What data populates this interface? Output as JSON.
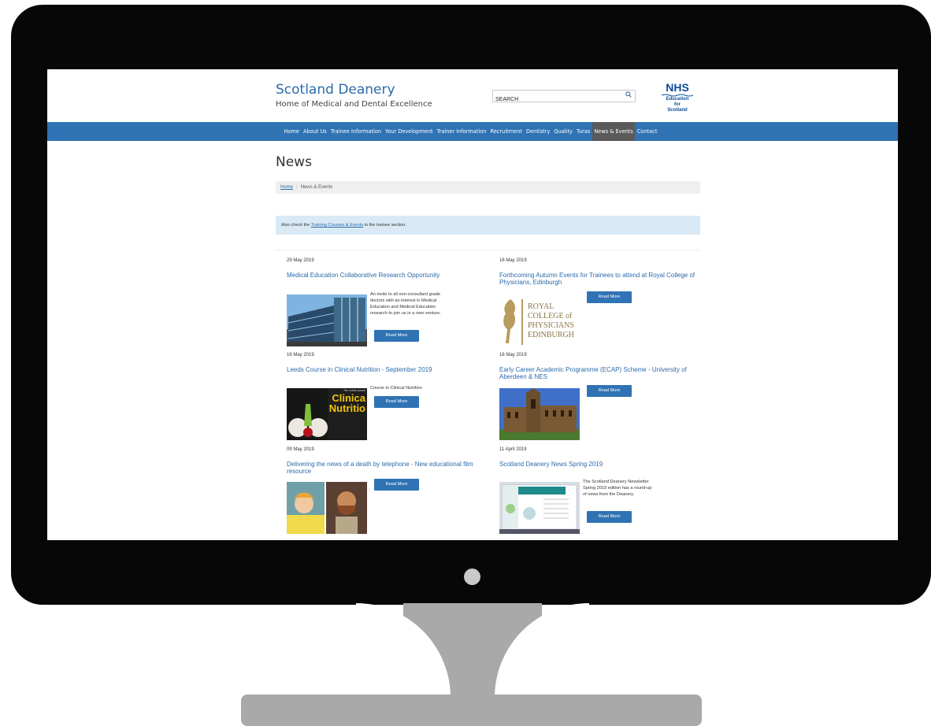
{
  "header": {
    "brand_title": "Scotland Deanery",
    "brand_subtitle": "Home of Medical and Dental Excellence",
    "search_placeholder": "SEARCH",
    "search_icon": "magnifier-icon",
    "nhs_logo": {
      "mark": "NHS",
      "line1": "Education",
      "line2": "for",
      "line3": "Scotland"
    }
  },
  "nav": {
    "items": [
      {
        "label": "Home"
      },
      {
        "label": "About Us"
      },
      {
        "label": "Trainee Information"
      },
      {
        "label": "Your Development"
      },
      {
        "label": "Trainer Information"
      },
      {
        "label": "Recruitment"
      },
      {
        "label": "Dentistry"
      },
      {
        "label": "Quality"
      },
      {
        "label": "Turas"
      },
      {
        "label": "News & Events"
      },
      {
        "label": "Contact"
      }
    ],
    "active": "News & Events"
  },
  "page": {
    "title": "News",
    "breadcrumb": {
      "home": "Home",
      "separator": "/",
      "current": "News & Events"
    },
    "alert": {
      "prefix": "Also check the ",
      "link": "Training Courses & Events",
      "suffix": " in the trainee section."
    }
  },
  "news": [
    {
      "date": "29 May 2019",
      "title": "Medical Education Collaborative Research Opportunity",
      "description": "An invite to all non-consultant grade doctors with an interest in Medical Education and Medical Education research to join us in a new venture.",
      "button": "Read More"
    },
    {
      "date": "16 May 2019",
      "title": "Forthcoming Autumn Events for Trainees to attend at Royal College of Physicians, Edinburgh",
      "description": "",
      "button": "Read More",
      "image_text": {
        "line1": "ROYAL",
        "line2": "COLLEGE of",
        "line3": "PHYSICIANS",
        "line4": "EDINBURGH"
      }
    },
    {
      "date": "16 May 2019",
      "title": "Leeds Course in Clinical Nutrition - September 2019",
      "description": "Course in Clinical Nutrition",
      "button": "Read More",
      "image_text": {
        "line1": "The Leeds course",
        "line2": "Clinica",
        "line3": "Nutritio"
      }
    },
    {
      "date": "16 May 2019",
      "title": "Early Career Academic Programme (ECAP) Scheme - University of Aberdeen & NES",
      "description": "",
      "button": "Read More"
    },
    {
      "date": "09 May 2019",
      "title": "Delivering the news of a death by telephone - New educational film resource",
      "description": "",
      "button": "Read More"
    },
    {
      "date": "11 April 2019",
      "title": "Scotland Deanery News Spring 2019",
      "description": "The Scotland Deanery Newsletter Spring 2019 edition has a round-up of news from the Deanery.",
      "button": "Read More"
    }
  ],
  "colors": {
    "nav": "#2f73b4",
    "active_nav": "#5a5a5a",
    "link": "#2b6aa9",
    "alert_bg": "#d9eaf6",
    "bezel": "#070707",
    "stand": "#a9a9a9"
  }
}
